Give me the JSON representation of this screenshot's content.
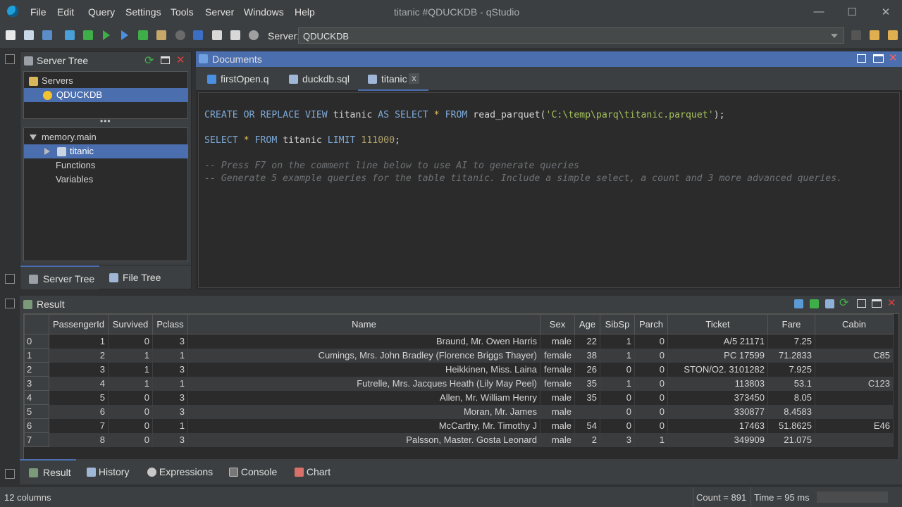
{
  "window": {
    "title": "titanic #QDUCKDB - qStudio"
  },
  "menu": [
    "File",
    "Edit",
    "Query",
    "Settings",
    "Tools",
    "Server",
    "Windows",
    "Help"
  ],
  "toolbar": {
    "server_label": "Server:",
    "server_value": "QDUCKDB"
  },
  "server_tree": {
    "title": "Server Tree",
    "servers_label": "Servers",
    "server": "QDUCKDB",
    "schema": "memory.main",
    "table": "titanic",
    "functions": "Functions",
    "variables": "Variables",
    "tabs": [
      "Server Tree",
      "File Tree"
    ]
  },
  "documents": {
    "title": "Documents",
    "tabs": [
      "firstOpen.q",
      "duckdb.sql",
      "titanic"
    ],
    "tab_close": "x",
    "code": {
      "l1": [
        "CREATE",
        "OR",
        "REPLACE",
        "VIEW",
        "titanic",
        "AS",
        "SELECT",
        "*",
        "FROM",
        "read_parquet(",
        "'C:\\temp\\parq\\titanic.parquet'",
        ");"
      ],
      "l2": [
        "SELECT",
        "*",
        "FROM",
        "titanic",
        "LIMIT",
        "111000",
        ";"
      ],
      "c1": "-- Press F7 on the comment line below to use AI to generate queries",
      "c2": "-- Generate 5 example queries for the table titanic. Include a simple select, a count and 3 more advanced queries."
    }
  },
  "result": {
    "title": "Result",
    "columns": [
      "PassengerId",
      "Survived",
      "Pclass",
      "Name",
      "Sex",
      "Age",
      "SibSp",
      "Parch",
      "Ticket",
      "Fare",
      "Cabin"
    ],
    "rows": [
      [
        "0",
        "1",
        "0",
        "3",
        "Braund, Mr. Owen Harris",
        "male",
        "22",
        "1",
        "0",
        "A/5 21171",
        "7.25",
        ""
      ],
      [
        "1",
        "2",
        "1",
        "1",
        "Cumings, Mrs. John Bradley (Florence Briggs Thayer)",
        "female",
        "38",
        "1",
        "0",
        "PC 17599",
        "71.2833",
        "C85"
      ],
      [
        "2",
        "3",
        "1",
        "3",
        "Heikkinen, Miss. Laina",
        "female",
        "26",
        "0",
        "0",
        "STON/O2. 3101282",
        "7.925",
        ""
      ],
      [
        "3",
        "4",
        "1",
        "1",
        "Futrelle, Mrs. Jacques Heath (Lily May Peel)",
        "female",
        "35",
        "1",
        "0",
        "113803",
        "53.1",
        "C123"
      ],
      [
        "4",
        "5",
        "0",
        "3",
        "Allen, Mr. William Henry",
        "male",
        "35",
        "0",
        "0",
        "373450",
        "8.05",
        ""
      ],
      [
        "5",
        "6",
        "0",
        "3",
        "Moran, Mr. James",
        "male",
        "",
        "0",
        "0",
        "330877",
        "8.4583",
        ""
      ],
      [
        "6",
        "7",
        "0",
        "1",
        "McCarthy, Mr. Timothy J",
        "male",
        "54",
        "0",
        "0",
        "17463",
        "51.8625",
        "E46"
      ],
      [
        "7",
        "8",
        "0",
        "3",
        "Palsson, Master. Gosta Leonard",
        "male",
        "2",
        "3",
        "1",
        "349909",
        "21.075",
        ""
      ]
    ]
  },
  "bottom_tabs": [
    "Result",
    "History",
    "Expressions",
    "Console",
    "Chart"
  ],
  "status": {
    "columns": "12 columns",
    "count": "Count = 891",
    "time": "Time = 95 ms"
  }
}
